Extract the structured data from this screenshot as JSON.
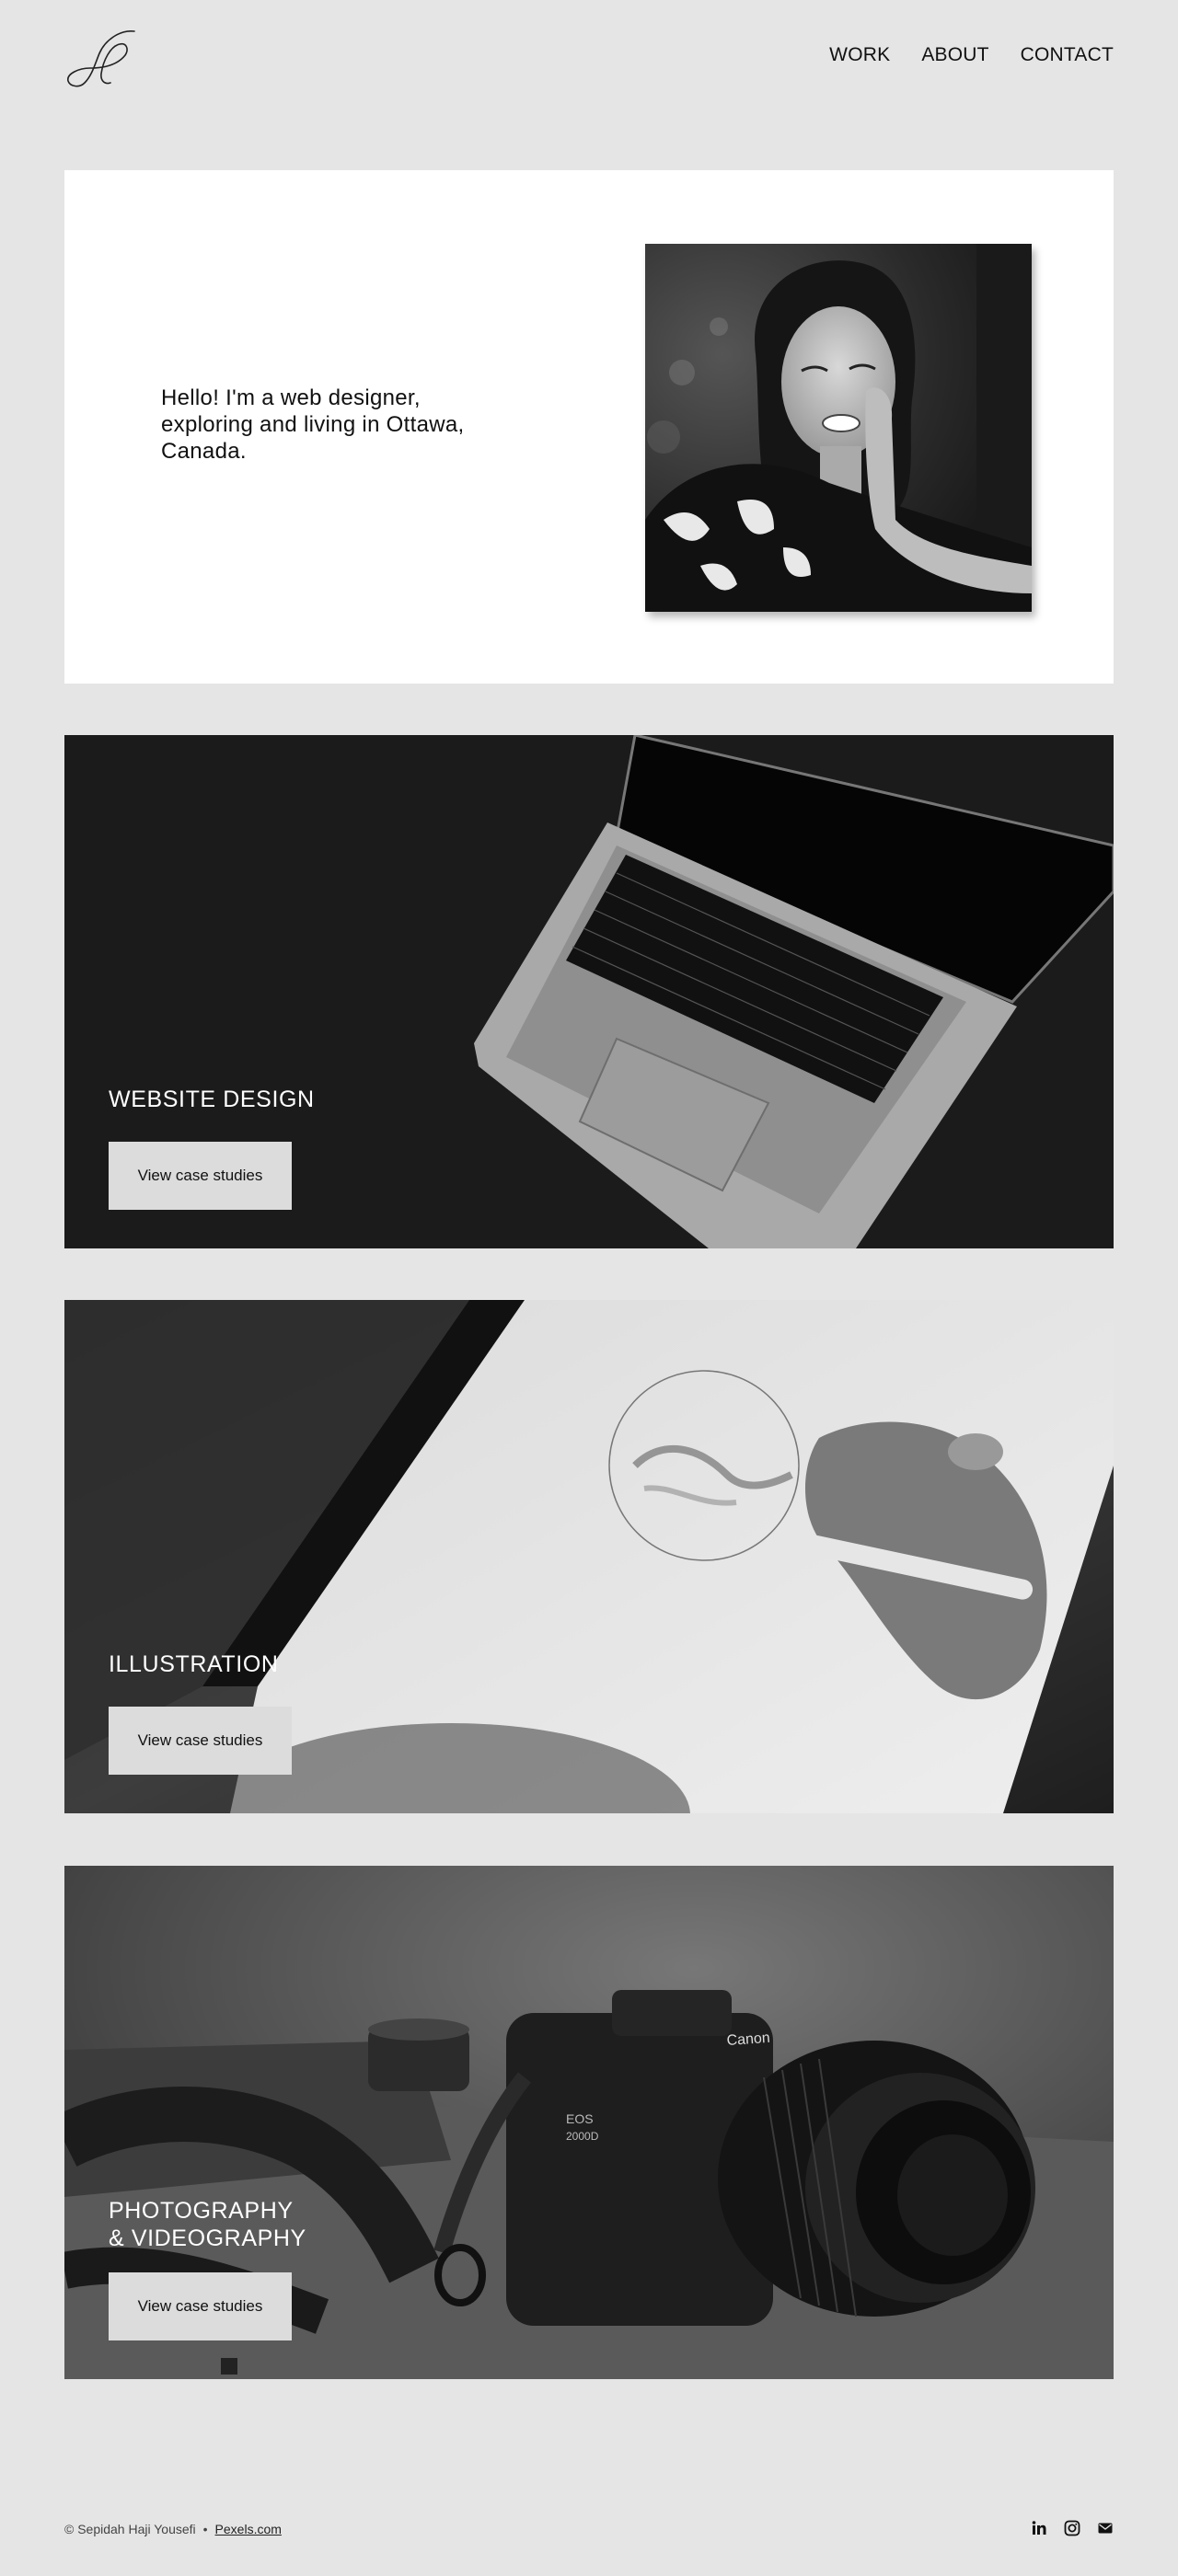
{
  "nav": {
    "work": "WORK",
    "about": "ABOUT",
    "contact": "CONTACT"
  },
  "intro": {
    "text": "Hello! I'm a web designer, exploring and living in Ottawa, Canada."
  },
  "cards": [
    {
      "title": "WEBSITE DESIGN",
      "button": "View case studies"
    },
    {
      "title": "ILLUSTRATION",
      "button": "View case studies"
    },
    {
      "title_line1": "PHOTOGRAPHY",
      "title_line2": "& VIDEOGRAPHY",
      "button": "View case studies"
    }
  ],
  "footer": {
    "copyright": "© Sepidah Haji Yousefi",
    "separator": "•",
    "link": "Pexels.com"
  },
  "socials": [
    "linkedin-icon",
    "instagram-icon",
    "email-icon"
  ],
  "colors": {
    "background": "#e5e5e5",
    "card_button": "#dcdcdc",
    "text": "#111111"
  }
}
